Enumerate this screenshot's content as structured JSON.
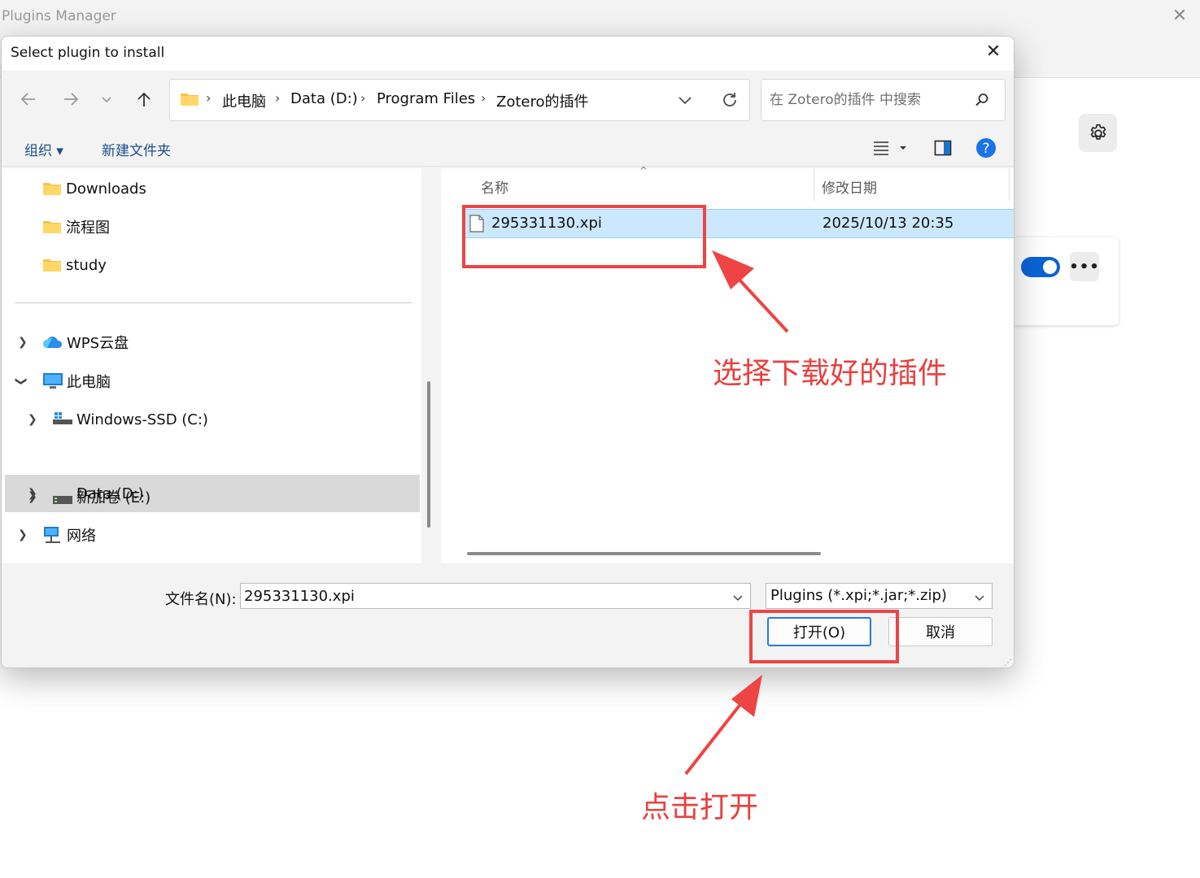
{
  "background_window": {
    "title": "Plugins Manager",
    "close_glyph": "✕",
    "more_glyph": "•••",
    "toggle_on": true
  },
  "dialog": {
    "title": "Select plugin to install",
    "close_glyph": "✕",
    "breadcrumbs": [
      "此电脑",
      "Data (D:)",
      "Program Files",
      "Zotero的插件"
    ],
    "search_placeholder": "在 Zotero的插件 中搜索",
    "cmd": {
      "organize": "组织 ▾",
      "new_folder": "新建文件夹"
    },
    "tree": {
      "quick": [
        "Downloads",
        "流程图",
        "study"
      ],
      "wps": "WPS云盘",
      "this_pc": "此电脑",
      "drives": [
        "Windows-SSD (C:)",
        "Data (D:)",
        "新加卷 (E:)"
      ],
      "network": "网络"
    },
    "columns": {
      "name": "名称",
      "date": "修改日期"
    },
    "files": [
      {
        "name": "295331130.xpi",
        "date": "2025/10/13 20:35",
        "selected": true
      }
    ],
    "filename_label": "文件名(N):",
    "filename_value": "295331130.xpi",
    "filetype_value": "Plugins (*.xpi;*.jar;*.zip)",
    "open_button": "打开(O)",
    "cancel_button": "取消"
  },
  "annotations": {
    "select_hint": "选择下载好的插件",
    "click_hint": "点击打开",
    "color": "#ee4444"
  }
}
